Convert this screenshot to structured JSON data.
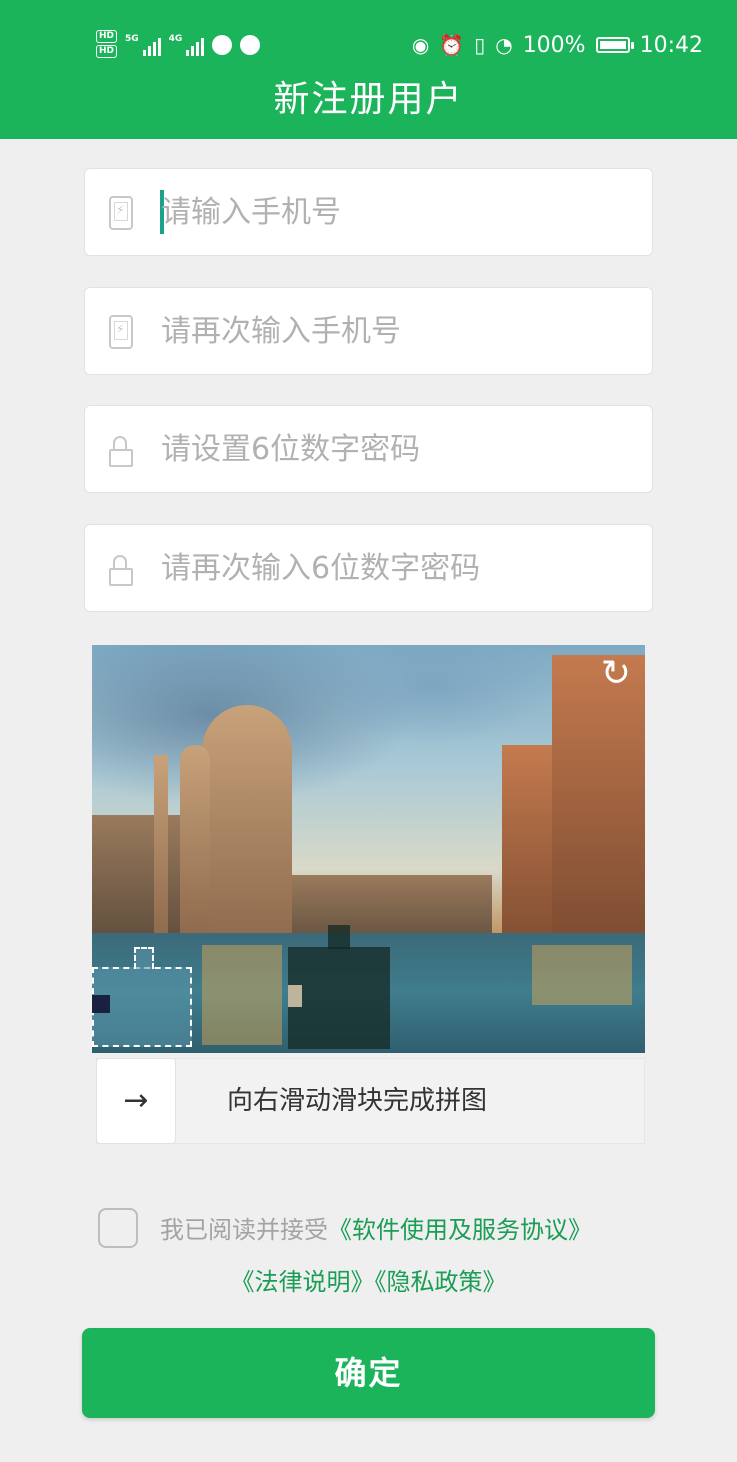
{
  "status_bar": {
    "hd1": "HD",
    "hd2": "HD",
    "net1": "5G",
    "net2": "4G",
    "battery": "100%",
    "time": "10:42"
  },
  "header": {
    "title": "新注册用户"
  },
  "form": {
    "phone": {
      "placeholder": "请输入手机号",
      "value": ""
    },
    "phone_confirm": {
      "placeholder": "请再次输入手机号",
      "value": ""
    },
    "password": {
      "placeholder": "请设置6位数字密码",
      "value": ""
    },
    "password_confirm": {
      "placeholder": "请再次输入6位数字密码",
      "value": ""
    }
  },
  "captcha": {
    "slider_arrow": "→",
    "slider_text": "向右滑动滑块完成拼图",
    "refresh_glyph": "↻"
  },
  "agreement": {
    "prefix": "我已阅读并接受",
    "link_service": "《软件使用及服务协议》",
    "link_legal": "《法律说明》",
    "link_privacy": "《隐私政策》",
    "checked": false
  },
  "confirm_label": "确定",
  "colors": {
    "brand": "#1bb45a",
    "link": "#1a9d55"
  }
}
